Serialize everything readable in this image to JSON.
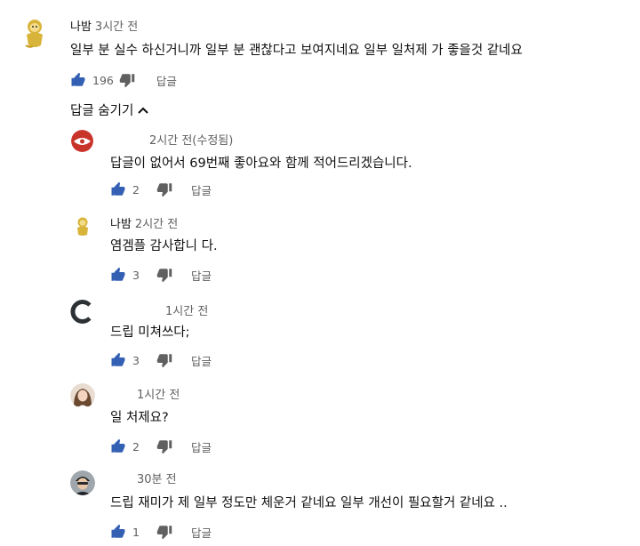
{
  "top_comment": {
    "author": "나밤",
    "time": "3시간 전",
    "text": "일부 분 실수 하신거니까 일부 분 괜찮다고 보여지네요 일부 일처제 가 좋을것 같네요",
    "likes": "196",
    "reply_label": "답글"
  },
  "hide_replies_label": "답글 숨기기",
  "replies": [
    {
      "author": "",
      "time": "2시간 전(수정됨)",
      "text": "답글이 없어서 69번째 좋아요와 함께 적어드리겠습니다.",
      "likes": "2",
      "reply_label": "답글"
    },
    {
      "author": "나밤",
      "time": "2시간 전",
      "text": "염겜플 감사합니 다.",
      "likes": "3",
      "reply_label": "답글"
    },
    {
      "author": "",
      "time": "1시간 전",
      "text": "드립 미쳐쓰다;",
      "likes": "3",
      "reply_label": "답글"
    },
    {
      "author": "",
      "time": "1시간 전",
      "text": "일 처제요?",
      "likes": "2",
      "reply_label": "답글"
    },
    {
      "author": "",
      "time": "30분 전",
      "text": "드립 재미가 제 일부 정도만 체운거 같네요 일부 개선이 필요할거 같네요 ..",
      "likes": "1",
      "reply_label": "답글"
    }
  ],
  "colors": {
    "like_blue": "#3460b4",
    "icon_gray": "#606060"
  },
  "icons": {
    "like": "thumbs-up-icon",
    "dislike": "thumbs-down-icon",
    "chevron": "chevron-up-icon"
  }
}
